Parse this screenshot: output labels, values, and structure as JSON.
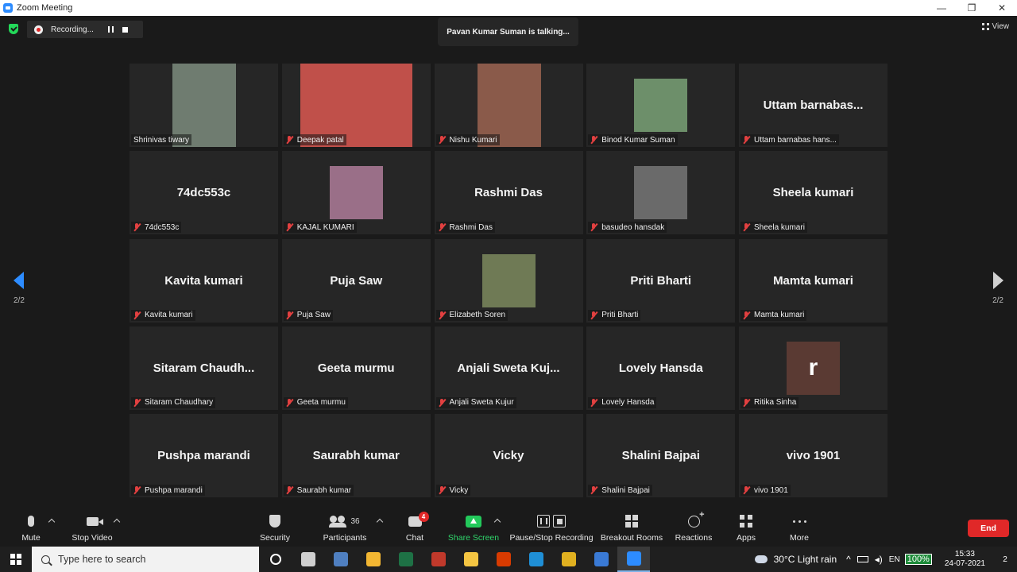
{
  "window": {
    "title": "Zoom Meeting",
    "controls": [
      "—",
      "❐",
      "✕"
    ]
  },
  "meeting": {
    "recording_label": "Recording...",
    "talking_banner": "Pavan Kumar Suman is talking...",
    "view_label": "View",
    "page_left": "2/2",
    "page_right": "2/2"
  },
  "participants": [
    {
      "label": "Shrinivas tiwary",
      "big": "",
      "muted": false,
      "video": "lg",
      "color": "#6f7c70"
    },
    {
      "label": "Deepak patal",
      "big": "",
      "muted": true,
      "video": "wide",
      "color": "#c0504a"
    },
    {
      "label": "Nishu Kumari",
      "big": "",
      "muted": true,
      "video": "lg",
      "color": "#8a5a4a"
    },
    {
      "label": "Binod Kumar Suman",
      "big": "",
      "muted": true,
      "video": "sm",
      "color": "#6d8f6a"
    },
    {
      "label": "Uttam barnabas hans...",
      "big": "Uttam  barnabas...",
      "muted": true,
      "video": "",
      "color": ""
    },
    {
      "label": "74dc553c",
      "big": "74dc553c",
      "muted": true,
      "video": "",
      "color": ""
    },
    {
      "label": "KAJAL KUMARI",
      "big": "",
      "muted": true,
      "video": "sm",
      "color": "#9a6f88"
    },
    {
      "label": "Rashmi Das",
      "big": "Rashmi Das",
      "muted": true,
      "video": "",
      "color": ""
    },
    {
      "label": "basudeo hansdak",
      "big": "",
      "muted": true,
      "video": "sm",
      "color": "#6a6a6a"
    },
    {
      "label": "Sheela kumari",
      "big": "Sheela kumari",
      "muted": true,
      "video": "",
      "color": ""
    },
    {
      "label": "Kavita kumari",
      "big": "Kavita kumari",
      "muted": true,
      "video": "",
      "color": ""
    },
    {
      "label": "Puja Saw",
      "big": "Puja Saw",
      "muted": true,
      "video": "",
      "color": ""
    },
    {
      "label": "Elizabeth Soren",
      "big": "",
      "muted": true,
      "video": "sm",
      "color": "#6f7a55"
    },
    {
      "label": "Priti Bharti",
      "big": "Priti Bharti",
      "muted": true,
      "video": "",
      "color": ""
    },
    {
      "label": "Mamta kumari",
      "big": "Mamta kumari",
      "muted": true,
      "video": "",
      "color": ""
    },
    {
      "label": "Sitaram Chaudhary",
      "big": "Sitaram  Chaudh...",
      "muted": true,
      "video": "",
      "color": ""
    },
    {
      "label": "Geeta murmu",
      "big": "Geeta murmu",
      "muted": true,
      "video": "",
      "color": ""
    },
    {
      "label": "Anjali Sweta Kujur",
      "big": "Anjali  Sweta  Kuj...",
      "muted": true,
      "video": "",
      "color": ""
    },
    {
      "label": "Lovely Hansda",
      "big": "Lovely Hansda",
      "muted": true,
      "video": "",
      "color": ""
    },
    {
      "label": "Ritika Sinha",
      "big": "",
      "muted": true,
      "video": "avatar",
      "avatar_letter": "r",
      "color": "#5a3a33"
    },
    {
      "label": "Pushpa marandi",
      "big": "Pushpa marandi",
      "muted": true,
      "video": "",
      "color": ""
    },
    {
      "label": "Saurabh kumar",
      "big": "Saurabh kumar",
      "muted": true,
      "video": "",
      "color": ""
    },
    {
      "label": "Vicky",
      "big": "Vicky",
      "muted": true,
      "video": "",
      "color": ""
    },
    {
      "label": "Shalini Bajpai",
      "big": "Shalini Bajpai",
      "muted": true,
      "video": "",
      "color": ""
    },
    {
      "label": "vivo 1901",
      "big": "vivo 1901",
      "muted": true,
      "video": "",
      "color": ""
    }
  ],
  "toolbar": {
    "mute": "Mute",
    "stop_video": "Stop Video",
    "security": "Security",
    "participants": "Participants",
    "participants_count": "36",
    "chat": "Chat",
    "chat_badge": "4",
    "share_screen": "Share Screen",
    "pause_stop_recording": "Pause/Stop Recording",
    "breakout_rooms": "Breakout Rooms",
    "reactions": "Reactions",
    "apps": "Apps",
    "more": "More",
    "end": "End"
  },
  "taskbar": {
    "search_placeholder": "Type here to search",
    "apps": [
      {
        "name": "task-view",
        "color": "#ffffff"
      },
      {
        "name": "widgets",
        "color": "#cfcfcf"
      },
      {
        "name": "app-blue",
        "color": "#4f7fc0"
      },
      {
        "name": "store",
        "color": "#f2b632"
      },
      {
        "name": "excel",
        "color": "#1e7145"
      },
      {
        "name": "app-red",
        "color": "#c0392b"
      },
      {
        "name": "file-explorer",
        "color": "#f4c542"
      },
      {
        "name": "office",
        "color": "#d83b01"
      },
      {
        "name": "edge",
        "color": "#1f8fd6"
      },
      {
        "name": "chrome",
        "color": "#e0b020"
      },
      {
        "name": "photos",
        "color": "#3a7ad5"
      },
      {
        "name": "zoom",
        "color": "#2d8cff"
      }
    ],
    "lang": "EN",
    "battery": "100%",
    "weather": "30°C  Light rain",
    "time": "15:33",
    "date": "24-07-2021",
    "notifications": "2"
  }
}
